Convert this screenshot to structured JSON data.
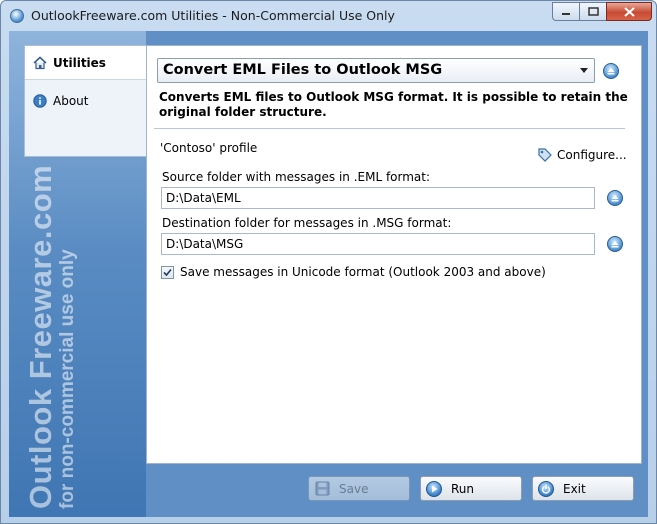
{
  "window": {
    "title": "OutlookFreeware.com Utilities - Non-Commercial Use Only"
  },
  "sidebar": {
    "items": [
      {
        "label": "Utilities",
        "icon": "home-icon",
        "selected": true
      },
      {
        "label": "About",
        "icon": "info-icon",
        "selected": false
      }
    ],
    "watermark_line1": "Outlook Freeware.com",
    "watermark_line2": "for non-commercial use only"
  },
  "main": {
    "utility_select": "Convert EML Files to Outlook MSG",
    "description": "Converts EML files to Outlook MSG format. It is possible to retain the original folder structure.",
    "profile": "'Contoso' profile",
    "configure_label": "Configure...",
    "source_label": "Source folder with messages in .EML format:",
    "source_value": "D:\\Data\\EML",
    "dest_label": "Destination folder for messages in .MSG format:",
    "dest_value": "D:\\Data\\MSG",
    "unicode_label": "Save messages in Unicode format (Outlook 2003 and above)",
    "unicode_checked": true
  },
  "buttons": {
    "save": "Save",
    "run": "Run",
    "exit": "Exit"
  },
  "colors": {
    "accent": "#3f86cf",
    "sidebar": "#5a8cc3",
    "close": "#c74b32"
  }
}
